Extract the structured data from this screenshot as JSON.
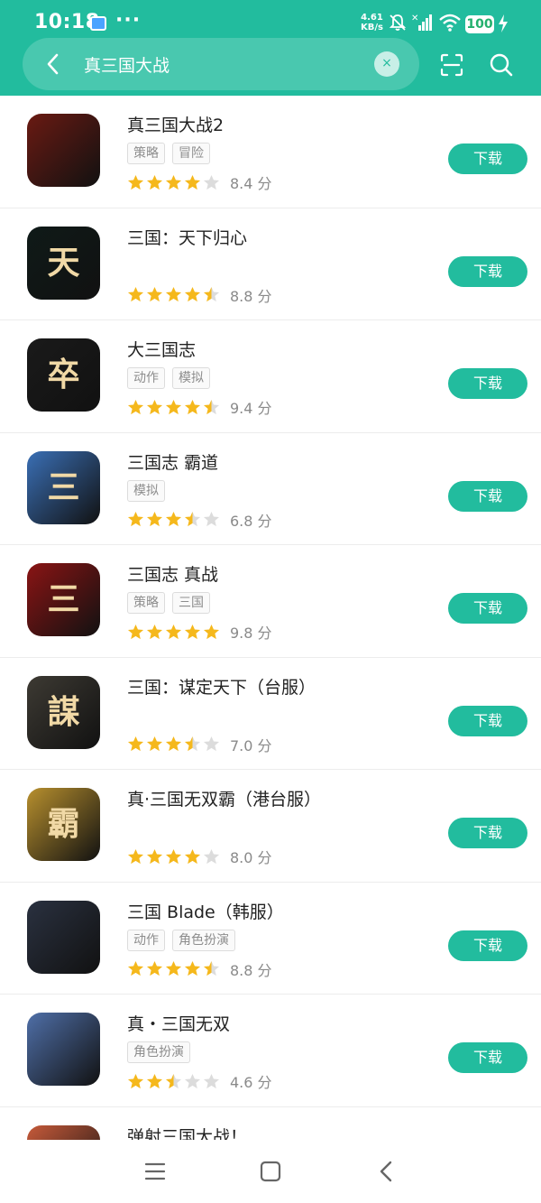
{
  "status_bar": {
    "time": "10:18",
    "dots": "···",
    "net_speed": "4.61",
    "net_unit": "KB/s",
    "battery": "100"
  },
  "search": {
    "query": "真三国大战",
    "clear_symbol": "×"
  },
  "colors": {
    "accent": "#22bc9e",
    "star_on": "#f5b81c",
    "star_off": "#dcdcdc"
  },
  "apps": [
    {
      "name": "真三国大战2",
      "tags": [
        "策略",
        "冒险"
      ],
      "stars": 4,
      "score": "8.4 分",
      "button": "下载",
      "icon_char": "",
      "icon_color": "#6a1a12"
    },
    {
      "name": "三国：天下归心",
      "tags": [],
      "stars": 4.5,
      "score": "8.8 分",
      "button": "下载",
      "icon_char": "天",
      "icon_color": "#0f1a18"
    },
    {
      "name": "大三国志",
      "tags": [
        "动作",
        "模拟"
      ],
      "stars": 4.5,
      "score": "9.4 分",
      "button": "下载",
      "icon_char": "卒",
      "icon_color": "#1a1a1a"
    },
    {
      "name": "三国志 霸道",
      "tags": [
        "模拟"
      ],
      "stars": 3.5,
      "score": "6.8 分",
      "button": "下载",
      "icon_char": "三",
      "icon_color": "#3a6fb5"
    },
    {
      "name": "三国志 真战",
      "tags": [
        "策略",
        "三国"
      ],
      "stars": 5,
      "score": "9.8 分",
      "button": "下载",
      "icon_char": "三",
      "icon_color": "#8a1414"
    },
    {
      "name": "三国：谋定天下（台服）",
      "tags": [],
      "stars": 3.5,
      "score": "7.0 分",
      "button": "下载",
      "icon_char": "謀",
      "icon_color": "#3d3a33"
    },
    {
      "name": "真·三国无双霸（港台服）",
      "tags": [],
      "stars": 4,
      "score": "8.0 分",
      "button": "下载",
      "icon_char": "霸",
      "icon_color": "#b8902e"
    },
    {
      "name": "三国 Blade（韩服）",
      "tags": [
        "动作",
        "角色扮演"
      ],
      "stars": 4.5,
      "score": "8.8 分",
      "button": "下载",
      "icon_char": "",
      "icon_color": "#2a3140"
    },
    {
      "name": "真・三国无双",
      "tags": [
        "角色扮演"
      ],
      "stars": 2.5,
      "score": "4.6 分",
      "button": "下载",
      "icon_char": "",
      "icon_color": "#4f6fa8"
    },
    {
      "name": "弹射三国大战！",
      "tags": [],
      "stars": 0,
      "score": "",
      "button": "",
      "icon_char": "",
      "icon_color": "#c65a3a"
    }
  ],
  "nav": {
    "menu_icon": "menu-icon",
    "home_icon": "home-square-icon",
    "back_icon": "back-chevron-icon"
  }
}
